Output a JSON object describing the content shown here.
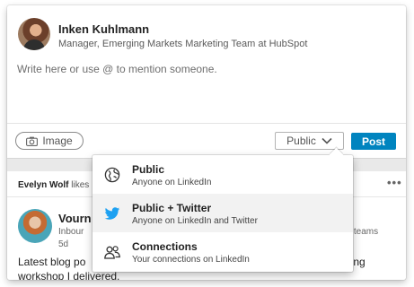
{
  "composer": {
    "user_name": "Inken Kuhlmann",
    "user_headline": "Manager, Emerging Markets Marketing Team at HubSpot",
    "placeholder": "Write here or use @ to mention someone.",
    "image_label": "Image",
    "visibility_label": "Public",
    "post_label": "Post",
    "post_button_color": "#0084bf"
  },
  "feed": {
    "actor": "Evelyn Wolf",
    "action": "likes",
    "poster_name": "Vourn",
    "poster_headline": "Inbour",
    "poster_headline_tail": "ng teams",
    "poster_time": "5d",
    "text_line_1": "Latest blog po",
    "text_line_1_tail": "ning",
    "text_line_2": "workshop I delivered."
  },
  "visibility_menu": {
    "options": [
      {
        "icon": "globe-icon",
        "title": "Public",
        "subtitle": "Anyone on LinkedIn"
      },
      {
        "icon": "twitter-bird-icon",
        "title": "Public + Twitter",
        "subtitle": "Anyone on LinkedIn and Twitter"
      },
      {
        "icon": "people-icon",
        "title": "Connections",
        "subtitle": "Your connections on LinkedIn"
      }
    ],
    "twitter_color": "#1da1f2"
  }
}
